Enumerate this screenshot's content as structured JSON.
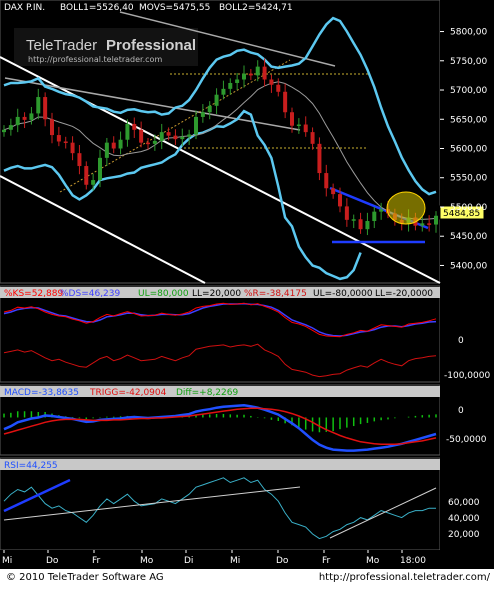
{
  "footer": {
    "copyright": "© 2010 TeleTrader Software AG",
    "url": "http://professional.teletrader.com/"
  },
  "watermark": {
    "brand_1": "TeleTrader",
    "brand_2": "Professional",
    "url": "http://professional.teletrader.com"
  },
  "colors": {
    "background": "#000000",
    "bollinger": "#5cc8f0",
    "up_candle": "#2e9a2e",
    "down_candle": "#c81e1e",
    "trendline_white": "#ffffff",
    "trendline_blue": "#1e3cff",
    "trendline_grey": "#a9a9a9",
    "highlight_circle": "#ffd400",
    "stoch_k": "#ff0000",
    "stoch_d": "#3f3fff",
    "williams_r": "#d01010",
    "macd": "#2050ff",
    "trigger": "#e01010",
    "hist_pos": "#10c010",
    "rsi": "#3ab0c8",
    "panel_header": "#c8c8c8"
  },
  "chart_data": [
    {
      "type": "candlestick",
      "legend": {
        "symbol": "DAX P.IN.",
        "boll1": "BOLL1=5526,40",
        "movs": "MOVS=5475,55",
        "boll2": "BOLL2=5424,71"
      },
      "ylim": [
        5370,
        5830
      ],
      "y_ticks": [
        "5800,00",
        "5750,00",
        "5700,00",
        "5650,00",
        "5600,00",
        "5550,00",
        "5500,00",
        "5450,00",
        "5400,00"
      ],
      "last_price_label": "5484,85",
      "closes": [
        5632,
        5640,
        5654,
        5649,
        5660,
        5688,
        5650,
        5623,
        5612,
        5610,
        5592,
        5570,
        5538,
        5546,
        5584,
        5610,
        5600,
        5615,
        5642,
        5632,
        5610,
        5608,
        5613,
        5628,
        5622,
        5616,
        5620,
        5624,
        5654,
        5662,
        5673,
        5692,
        5702,
        5712,
        5718,
        5728,
        5725,
        5740,
        5718,
        5709,
        5697,
        5662,
        5639,
        5641,
        5628,
        5608,
        5558,
        5532,
        5522,
        5501,
        5478,
        5479,
        5462,
        5476,
        5492,
        5496,
        5489,
        5478,
        5472,
        5482,
        5468,
        5472,
        5470,
        5485
      ],
      "boll_upper": [
        5708,
        5712,
        5712,
        5713,
        5715,
        5720,
        5706,
        5702,
        5697,
        5693,
        5691,
        5687,
        5680,
        5672,
        5670,
        5668,
        5663,
        5661,
        5666,
        5667,
        5664,
        5662,
        5663,
        5658,
        5660,
        5670,
        5673,
        5683,
        5700,
        5720,
        5738,
        5752,
        5757,
        5760,
        5767,
        5769,
        5764,
        5761,
        5752,
        5740,
        5738,
        5740,
        5742,
        5745,
        5755,
        5775,
        5795,
        5812,
        5823,
        5818,
        5800,
        5780,
        5760,
        5735,
        5705,
        5670,
        5638,
        5612,
        5585,
        5563,
        5544,
        5530,
        5522,
        5526
      ],
      "boll_lower": [
        5562,
        5567,
        5570,
        5566,
        5566,
        5569,
        5572,
        5568,
        5555,
        5537,
        5520,
        5513,
        5520,
        5530,
        5546,
        5549,
        5551,
        5553,
        5557,
        5559,
        5567,
        5570,
        5573,
        5576,
        5584,
        5590,
        5606,
        5617,
        5625,
        5627,
        5632,
        5638,
        5637,
        5643,
        5650,
        5664,
        5658,
        5622,
        5606,
        5584,
        5535,
        5482,
        5467,
        5432,
        5414,
        5400,
        5396,
        5387,
        5382,
        5377,
        5380,
        5392,
        5422
      ],
      "boll_upper_x0": 0,
      "boll_lower_x0": 0
    },
    {
      "type": "line",
      "legend": [
        "%KS=52,889",
        "%DS=46,239",
        "UL=80,000",
        "LL=20,000",
        "%R=-38,4175",
        "UL=-80,0000",
        "LL=-20,0000"
      ],
      "y_ticks": [
        "0",
        "-100,0000"
      ],
      "ylim": [
        0,
        100
      ],
      "series": [
        {
          "name": "%KS",
          "values": [
            70,
            74,
            82,
            80,
            83,
            78,
            70,
            64,
            60,
            58,
            52,
            48,
            42,
            46,
            56,
            64,
            60,
            66,
            71,
            66,
            60,
            61,
            62,
            67,
            64,
            62,
            65,
            70,
            80,
            84,
            86,
            90,
            92,
            89,
            90,
            92,
            88,
            91,
            84,
            78,
            70,
            56,
            44,
            40,
            34,
            24,
            14,
            10,
            9,
            8,
            14,
            18,
            24,
            22,
            30,
            38,
            36,
            34,
            32,
            40,
            42,
            44,
            48,
            53
          ]
        },
        {
          "name": "%DS",
          "values": [
            66,
            70,
            76,
            79,
            81,
            80,
            74,
            68,
            62,
            60,
            55,
            50,
            46,
            45,
            50,
            58,
            60,
            63,
            67,
            67,
            63,
            61,
            62,
            64,
            64,
            63,
            63,
            66,
            73,
            80,
            84,
            87,
            90,
            90,
            90,
            91,
            89,
            89,
            86,
            82,
            74,
            62,
            50,
            44,
            38,
            30,
            20,
            14,
            11,
            10,
            12,
            16,
            20,
            22,
            26,
            32,
            35,
            35,
            33,
            36,
            40,
            42,
            45,
            46
          ]
        },
        {
          "name": "%R",
          "values": [
            -30,
            -26,
            -22,
            -28,
            -24,
            -34,
            -44,
            -52,
            -48,
            -56,
            -62,
            -68,
            -70,
            -58,
            -46,
            -40,
            -52,
            -46,
            -36,
            -44,
            -52,
            -50,
            -48,
            -40,
            -46,
            -52,
            -44,
            -38,
            -20,
            -16,
            -12,
            -10,
            -8,
            -14,
            -10,
            -8,
            -12,
            -6,
            -22,
            -30,
            -40,
            -62,
            -76,
            -80,
            -84,
            -92,
            -96,
            -94,
            -90,
            -88,
            -78,
            -72,
            -66,
            -70,
            -58,
            -48,
            -56,
            -62,
            -66,
            -52,
            -46,
            -44,
            -40,
            -38
          ]
        }
      ]
    },
    {
      "type": "line",
      "legend": [
        "MACD=-33,8635",
        "TRIGG=-42,0904",
        "Diff=+8,2269"
      ],
      "y_ticks": [
        "0",
        "-50,0000"
      ],
      "ylim": [
        -75,
        40
      ],
      "series": [
        {
          "name": "MACD",
          "values": [
            -24,
            -18,
            -10,
            -6,
            -2,
            0,
            4,
            3,
            1,
            -1,
            -3,
            -6,
            -9,
            -8,
            -5,
            -4,
            -3,
            -2,
            0,
            1,
            0,
            -1,
            0,
            1,
            2,
            3,
            5,
            7,
            12,
            15,
            17,
            20,
            22,
            23,
            24,
            25,
            23,
            20,
            16,
            11,
            6,
            -3,
            -12,
            -22,
            -34,
            -46,
            -56,
            -62,
            -66,
            -67,
            -68,
            -68,
            -67,
            -66,
            -64,
            -62,
            -60,
            -57,
            -54,
            -50,
            -46,
            -42,
            -38,
            -34
          ]
        },
        {
          "name": "TRIGG",
          "values": [
            -34,
            -30,
            -26,
            -22,
            -18,
            -14,
            -10,
            -7,
            -5,
            -4,
            -4,
            -4,
            -5,
            -6,
            -6,
            -6,
            -5,
            -5,
            -4,
            -3,
            -2,
            -2,
            -1,
            -1,
            0,
            1,
            2,
            3,
            5,
            7,
            9,
            11,
            13,
            15,
            17,
            18,
            19,
            19,
            18,
            17,
            15,
            12,
            8,
            3,
            -3,
            -10,
            -18,
            -25,
            -31,
            -37,
            -42,
            -46,
            -50,
            -52,
            -54,
            -55,
            -55,
            -55,
            -54,
            -52,
            -50,
            -48,
            -45,
            -42
          ]
        },
        {
          "name": "Diff",
          "values": [
            10,
            12,
            16,
            16,
            16,
            14,
            14,
            10,
            6,
            3,
            1,
            -2,
            -4,
            -2,
            1,
            2,
            2,
            3,
            4,
            4,
            2,
            1,
            1,
            2,
            2,
            2,
            3,
            4,
            7,
            8,
            8,
            9,
            9,
            8,
            7,
            7,
            4,
            1,
            -2,
            -6,
            -9,
            -15,
            -20,
            -25,
            -31,
            -36,
            -38,
            -37,
            -35,
            -30,
            -26,
            -22,
            -17,
            -14,
            -10,
            -7,
            -5,
            -2,
            0,
            2,
            4,
            6,
            7,
            8
          ]
        }
      ]
    },
    {
      "type": "line",
      "legend": [
        "RSI=44,255"
      ],
      "y_ticks": [
        "60,000",
        "40,000",
        "20,000"
      ],
      "ylim": [
        10,
        75
      ],
      "series": [
        {
          "name": "RSI",
          "values": [
            50,
            56,
            60,
            58,
            62,
            55,
            48,
            44,
            46,
            42,
            40,
            36,
            32,
            38,
            46,
            52,
            48,
            52,
            56,
            50,
            46,
            47,
            48,
            52,
            50,
            48,
            52,
            56,
            62,
            64,
            66,
            68,
            70,
            66,
            68,
            70,
            66,
            68,
            60,
            56,
            50,
            40,
            32,
            30,
            28,
            22,
            18,
            20,
            24,
            26,
            30,
            32,
            36,
            34,
            38,
            42,
            40,
            38,
            36,
            40,
            42,
            42,
            44,
            44
          ]
        }
      ]
    }
  ],
  "x_axis": {
    "labels": [
      "Mi",
      "Do",
      "Fr",
      "Mo",
      "Di",
      "Mi",
      "Do",
      "Fr",
      "Mo",
      "18:00"
    ]
  }
}
